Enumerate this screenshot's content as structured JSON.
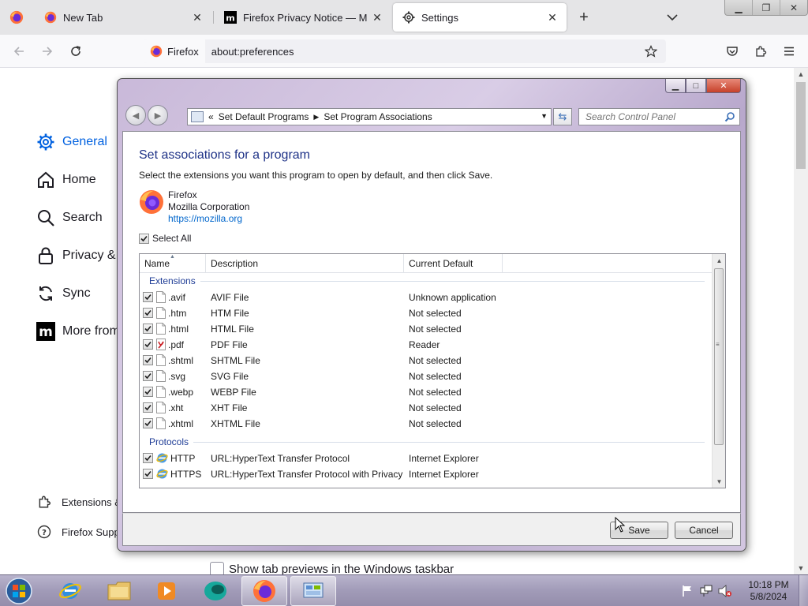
{
  "browser": {
    "tabs": [
      {
        "label": "New Tab",
        "icon": "firefox-logo"
      },
      {
        "label": "Firefox Privacy Notice — Mozilla",
        "icon": "mozilla-m-logo"
      },
      {
        "label": "Settings",
        "icon": "gear-icon",
        "selected": true
      }
    ],
    "identity_label": "Firefox",
    "url": "about:preferences"
  },
  "prefs": {
    "nav": [
      {
        "label": "General",
        "icon": "gear-icon",
        "selected": true
      },
      {
        "label": "Home",
        "icon": "home-icon"
      },
      {
        "label": "Search",
        "icon": "search-icon"
      },
      {
        "label": "Privacy & Security",
        "icon": "lock-icon"
      },
      {
        "label": "Sync",
        "icon": "sync-icon"
      },
      {
        "label": "More from Mozilla",
        "icon": "mozilla-m-icon"
      }
    ],
    "footer": [
      {
        "label": "Extensions & Themes",
        "icon": "puzzle-icon"
      },
      {
        "label": "Firefox Support",
        "icon": "help-icon"
      }
    ],
    "preview_label": "Show tab previews in the Windows taskbar"
  },
  "dialog": {
    "breadcrumb": [
      "Set Default Programs",
      "Set Program Associations"
    ],
    "breadcrumb_prefix": "«",
    "search_placeholder": "Search Control Panel",
    "heading": "Set associations for a program",
    "instruction": "Select the extensions you want this program to open by default, and then click Save.",
    "program": {
      "name": "Firefox",
      "publisher": "Mozilla Corporation",
      "url": "https://mozilla.org"
    },
    "select_all_label": "Select All",
    "columns": {
      "name": "Name",
      "description": "Description",
      "current": "Current Default"
    },
    "groups": {
      "extensions": {
        "label": "Extensions",
        "rows": [
          {
            "name": ".avif",
            "description": "AVIF File",
            "current": "Unknown application",
            "checked": true
          },
          {
            "name": ".htm",
            "description": "HTM File",
            "current": "Not selected",
            "checked": true
          },
          {
            "name": ".html",
            "description": "HTML File",
            "current": "Not selected",
            "checked": true
          },
          {
            "name": ".pdf",
            "description": "PDF File",
            "current": "Reader",
            "checked": true
          },
          {
            "name": ".shtml",
            "description": "SHTML File",
            "current": "Not selected",
            "checked": true
          },
          {
            "name": ".svg",
            "description": "SVG File",
            "current": "Not selected",
            "checked": true
          },
          {
            "name": ".webp",
            "description": "WEBP File",
            "current": "Not selected",
            "checked": true
          },
          {
            "name": ".xht",
            "description": "XHT File",
            "current": "Not selected",
            "checked": true
          },
          {
            "name": ".xhtml",
            "description": "XHTML File",
            "current": "Not selected",
            "checked": true
          }
        ]
      },
      "protocols": {
        "label": "Protocols",
        "rows": [
          {
            "name": "HTTP",
            "description": "URL:HyperText Transfer Protocol",
            "current": "Internet Explorer",
            "checked": true
          },
          {
            "name": "HTTPS",
            "description": "URL:HyperText Transfer Protocol with Privacy",
            "current": "Internet Explorer",
            "checked": true
          }
        ]
      }
    },
    "save_label": "Save",
    "cancel_label": "Cancel"
  },
  "taskbar": {
    "items": [
      "internet-explorer-icon",
      "windows-explorer-icon",
      "media-player-icon",
      "app-icon",
      "firefox-icon",
      "control-panel-icon"
    ],
    "time": "10:18 PM",
    "date": "5/8/2024"
  },
  "colors": {
    "heading": "#1e3287",
    "selected_nav": "#0061e0",
    "link": "#0066cc",
    "group_label": "#1e3c96"
  }
}
